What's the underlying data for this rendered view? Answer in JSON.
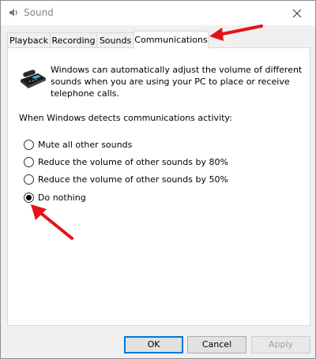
{
  "window": {
    "title": "Sound",
    "close_icon": "close-icon",
    "app_icon": "speaker-icon"
  },
  "tabs": [
    {
      "label": "Playback",
      "active": false
    },
    {
      "label": "Recording",
      "active": false
    },
    {
      "label": "Sounds",
      "active": false
    },
    {
      "label": "Communications",
      "active": true
    }
  ],
  "communications": {
    "info_text": "Windows can automatically adjust the volume of different sounds when you are using your PC to place or receive telephone calls.",
    "detect_text": "When Windows detects communications activity:",
    "options": [
      {
        "label": "Mute all other sounds",
        "checked": false
      },
      {
        "label": "Reduce the volume of other sounds by 80%",
        "checked": false
      },
      {
        "label": "Reduce the volume of other sounds by 50%",
        "checked": false
      },
      {
        "label": "Do nothing",
        "checked": true
      }
    ]
  },
  "buttons": {
    "ok": "OK",
    "cancel": "Cancel",
    "apply": "Apply"
  },
  "annotations": {
    "arrow_color": "#e8111a"
  }
}
